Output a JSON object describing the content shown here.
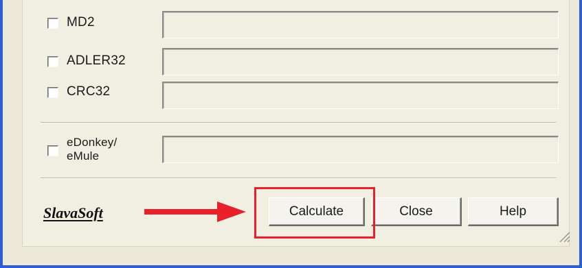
{
  "options": [
    {
      "label": "MD2",
      "checked": false,
      "value": ""
    },
    {
      "label": "ADLER32",
      "checked": false,
      "value": ""
    },
    {
      "label": "CRC32",
      "checked": false,
      "value": ""
    }
  ],
  "edonkey": {
    "label_line1": "eDonkey/",
    "label_line2": "eMule",
    "checked": false,
    "value": ""
  },
  "logo": {
    "text": "SlavaSoft"
  },
  "buttons": {
    "calculate": "Calculate",
    "close": "Close",
    "help": "Help"
  },
  "colors": {
    "frame": "#2e5ed6",
    "highlight": "#e8202a",
    "arrow": "#e8202a"
  },
  "icons": {
    "arrow": "right-arrow-icon",
    "grip": "resize-grip-icon"
  }
}
